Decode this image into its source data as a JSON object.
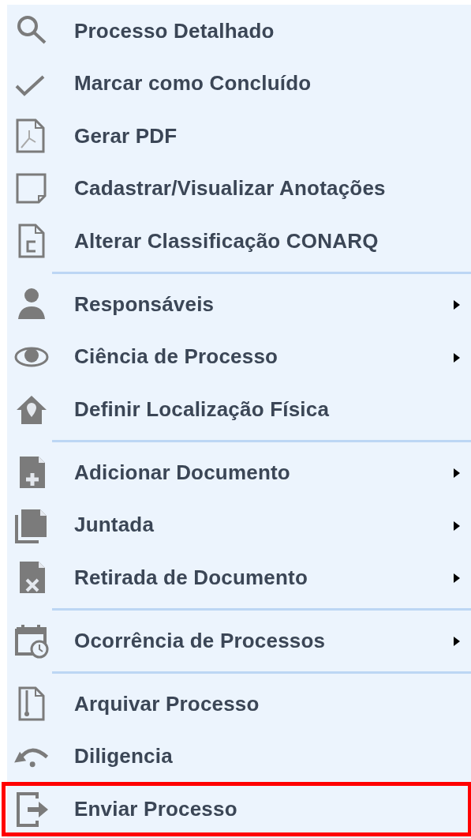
{
  "menu": {
    "items": [
      {
        "kind": "item",
        "label": "Processo Detalhado",
        "submenu": false,
        "highlighted": false
      },
      {
        "kind": "item",
        "label": "Marcar como Concluído",
        "submenu": false,
        "highlighted": false
      },
      {
        "kind": "item",
        "label": "Gerar PDF",
        "submenu": false,
        "highlighted": false
      },
      {
        "kind": "item",
        "label": "Cadastrar/Visualizar Anotações",
        "submenu": false,
        "highlighted": false
      },
      {
        "kind": "item",
        "label": "Alterar Classificação CONARQ",
        "submenu": false,
        "highlighted": false
      },
      {
        "kind": "separator"
      },
      {
        "kind": "item",
        "label": "Responsáveis",
        "submenu": true,
        "highlighted": false
      },
      {
        "kind": "item",
        "label": "Ciência de Processo",
        "submenu": true,
        "highlighted": false
      },
      {
        "kind": "item",
        "label": "Definir Localização Física",
        "submenu": false,
        "highlighted": false
      },
      {
        "kind": "separator"
      },
      {
        "kind": "item",
        "label": "Adicionar Documento",
        "submenu": true,
        "highlighted": false
      },
      {
        "kind": "item",
        "label": "Juntada",
        "submenu": true,
        "highlighted": false
      },
      {
        "kind": "item",
        "label": "Retirada de Documento",
        "submenu": true,
        "highlighted": false
      },
      {
        "kind": "separator"
      },
      {
        "kind": "item",
        "label": "Ocorrência de Processos",
        "submenu": true,
        "highlighted": false
      },
      {
        "kind": "separator"
      },
      {
        "kind": "item",
        "label": "Arquivar Processo",
        "submenu": false,
        "highlighted": false
      },
      {
        "kind": "item",
        "label": "Diligencia",
        "submenu": false,
        "highlighted": false
      },
      {
        "kind": "item",
        "label": "Enviar Processo",
        "submenu": false,
        "highlighted": true
      }
    ]
  }
}
